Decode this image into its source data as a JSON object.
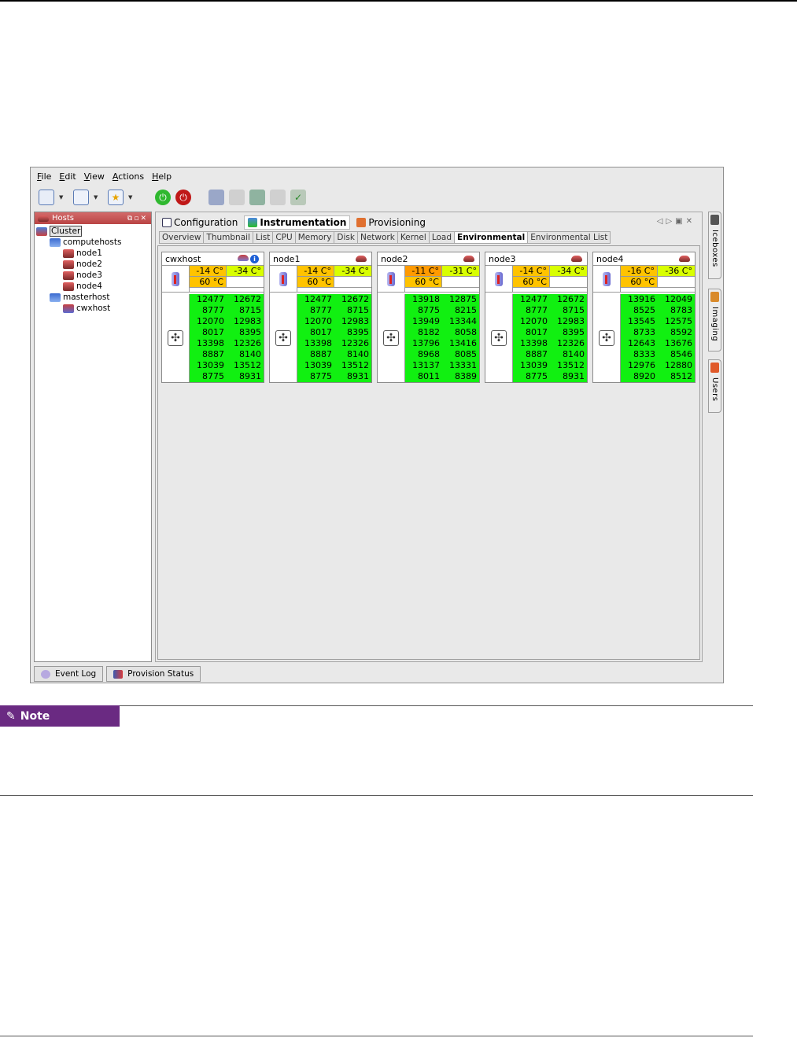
{
  "menu": [
    "File",
    "Edit",
    "View",
    "Actions",
    "Help"
  ],
  "hosts_panel": {
    "title": "Hosts",
    "tree": [
      {
        "label": "Cluster",
        "level": 0,
        "icon": "cluster-icon"
      },
      {
        "label": "computehosts",
        "level": 1,
        "icon": "group-icon"
      },
      {
        "label": "node1",
        "level": 2,
        "icon": "disk-icon"
      },
      {
        "label": "node2",
        "level": 2,
        "icon": "disk-icon"
      },
      {
        "label": "node3",
        "level": 2,
        "icon": "disk-icon"
      },
      {
        "label": "node4",
        "level": 2,
        "icon": "disk-icon"
      },
      {
        "label": "masterhost",
        "level": 1,
        "icon": "group-icon"
      },
      {
        "label": "cwxhost",
        "level": 2,
        "icon": "server-icon"
      }
    ]
  },
  "main_tabs": [
    {
      "label": "Configuration",
      "active": false
    },
    {
      "label": "Instrumentation",
      "active": true
    },
    {
      "label": "Provisioning",
      "active": false
    }
  ],
  "sub_tabs": [
    {
      "label": "Overview",
      "active": false
    },
    {
      "label": "Thumbnail",
      "active": false
    },
    {
      "label": "List",
      "active": false
    },
    {
      "label": "CPU",
      "active": false
    },
    {
      "label": "Memory",
      "active": false
    },
    {
      "label": "Disk",
      "active": false
    },
    {
      "label": "Network",
      "active": false
    },
    {
      "label": "Kernel",
      "active": false
    },
    {
      "label": "Load",
      "active": false
    },
    {
      "label": "Environmental",
      "active": true
    },
    {
      "label": "Environmental List",
      "active": false
    }
  ],
  "colors": {
    "temp_orange": "#ffc300",
    "temp_yellow": "#d8ff00",
    "temp_dark_orange": "#ff9a00",
    "fan_green": "#11f011"
  },
  "hosts": [
    {
      "name": "cwxhost",
      "icons": [
        "server-icon",
        "info-icon"
      ],
      "temps": [
        {
          "value": "-14 C°",
          "color": "#ffc300"
        },
        {
          "value": "-34 C°",
          "color": "#d8ff00"
        },
        {
          "value": "60 °C",
          "color": "#ffc300"
        },
        {
          "value": "",
          "color": "#ffffff"
        }
      ],
      "fans": [
        [
          "12477",
          "12672"
        ],
        [
          "8777",
          "8715"
        ],
        [
          "12070",
          "12983"
        ],
        [
          "8017",
          "8395"
        ],
        [
          "13398",
          "12326"
        ],
        [
          "8887",
          "8140"
        ],
        [
          "13039",
          "13512"
        ],
        [
          "8775",
          "8931"
        ]
      ]
    },
    {
      "name": "node1",
      "icons": [
        "disk-icon"
      ],
      "temps": [
        {
          "value": "-14 C°",
          "color": "#ffc300"
        },
        {
          "value": "-34 C°",
          "color": "#d8ff00"
        },
        {
          "value": "60 °C",
          "color": "#ffc300"
        },
        {
          "value": "",
          "color": "#ffffff"
        }
      ],
      "fans": [
        [
          "12477",
          "12672"
        ],
        [
          "8777",
          "8715"
        ],
        [
          "12070",
          "12983"
        ],
        [
          "8017",
          "8395"
        ],
        [
          "13398",
          "12326"
        ],
        [
          "8887",
          "8140"
        ],
        [
          "13039",
          "13512"
        ],
        [
          "8775",
          "8931"
        ]
      ]
    },
    {
      "name": "node2",
      "icons": [
        "disk-icon"
      ],
      "temps": [
        {
          "value": "-11 C°",
          "color": "#ff9a00"
        },
        {
          "value": "-31 C°",
          "color": "#d8ff00"
        },
        {
          "value": "60 °C",
          "color": "#ffc300"
        },
        {
          "value": "",
          "color": "#ffffff"
        }
      ],
      "fans": [
        [
          "13918",
          "12875"
        ],
        [
          "8775",
          "8215"
        ],
        [
          "13949",
          "13344"
        ],
        [
          "8182",
          "8058"
        ],
        [
          "13796",
          "13416"
        ],
        [
          "8968",
          "8085"
        ],
        [
          "13137",
          "13331"
        ],
        [
          "8011",
          "8389"
        ]
      ]
    },
    {
      "name": "node3",
      "icons": [
        "disk-icon"
      ],
      "temps": [
        {
          "value": "-14 C°",
          "color": "#ffc300"
        },
        {
          "value": "-34 C°",
          "color": "#d8ff00"
        },
        {
          "value": "60 °C",
          "color": "#ffc300"
        },
        {
          "value": "",
          "color": "#ffffff"
        }
      ],
      "fans": [
        [
          "12477",
          "12672"
        ],
        [
          "8777",
          "8715"
        ],
        [
          "12070",
          "12983"
        ],
        [
          "8017",
          "8395"
        ],
        [
          "13398",
          "12326"
        ],
        [
          "8887",
          "8140"
        ],
        [
          "13039",
          "13512"
        ],
        [
          "8775",
          "8931"
        ]
      ]
    },
    {
      "name": "node4",
      "icons": [
        "disk-icon"
      ],
      "temps": [
        {
          "value": "-16 C°",
          "color": "#ffc300"
        },
        {
          "value": "-36 C°",
          "color": "#d8ff00"
        },
        {
          "value": "60 °C",
          "color": "#ffc300"
        },
        {
          "value": "",
          "color": "#ffffff"
        }
      ],
      "fans": [
        [
          "13916",
          "12049"
        ],
        [
          "8525",
          "8783"
        ],
        [
          "13545",
          "12575"
        ],
        [
          "8733",
          "8592"
        ],
        [
          "12643",
          "13676"
        ],
        [
          "8333",
          "8546"
        ],
        [
          "12976",
          "12880"
        ],
        [
          "8920",
          "8512"
        ]
      ]
    }
  ],
  "side_tabs": [
    {
      "label": "Iceboxes",
      "icon": "icebox-icon"
    },
    {
      "label": "Imaging",
      "icon": "imaging-icon"
    },
    {
      "label": "Users",
      "icon": "users-icon"
    }
  ],
  "bottom_tabs": [
    {
      "label": "Event Log",
      "icon": "event-log-icon"
    },
    {
      "label": "Provision Status",
      "icon": "provision-status-icon"
    }
  ],
  "note": {
    "label": "Note"
  }
}
